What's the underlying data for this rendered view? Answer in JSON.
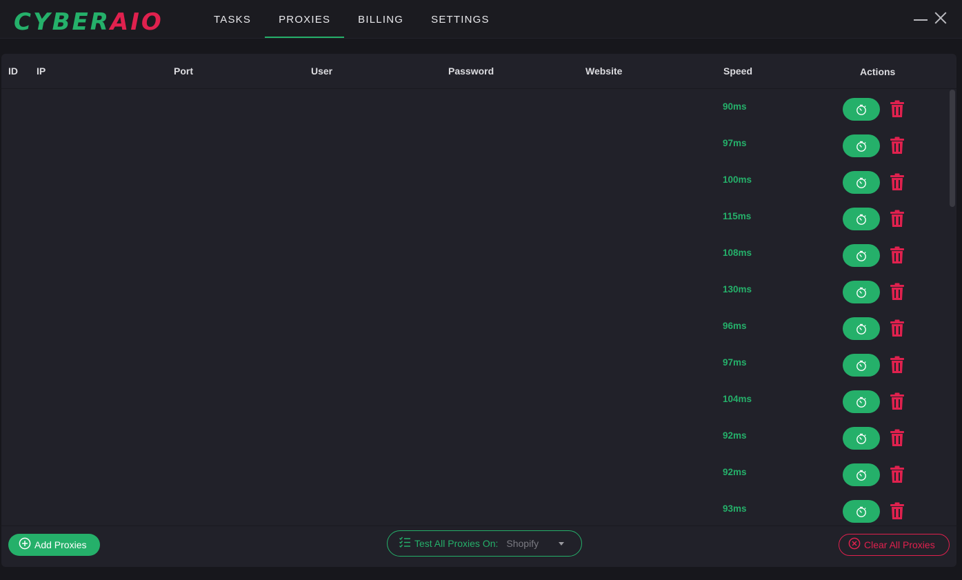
{
  "app": {
    "logo_part1": "CYBER",
    "logo_part2": "AIO",
    "accent_color": "#25b06a",
    "danger_color": "#e0214e"
  },
  "nav": {
    "tabs": [
      {
        "label": "TASKS",
        "active": false
      },
      {
        "label": "PROXIES",
        "active": true
      },
      {
        "label": "BILLING",
        "active": false
      },
      {
        "label": "SETTINGS",
        "active": false
      }
    ]
  },
  "window_controls": {
    "minimize_icon": "minimize-icon",
    "close_icon": "close-icon"
  },
  "table": {
    "columns": [
      "ID",
      "IP",
      "Port",
      "User",
      "Password",
      "Website",
      "Speed",
      "Actions"
    ],
    "rows": [
      {
        "speed": "90ms"
      },
      {
        "speed": "97ms"
      },
      {
        "speed": "100ms"
      },
      {
        "speed": "115ms"
      },
      {
        "speed": "108ms"
      },
      {
        "speed": "130ms"
      },
      {
        "speed": "96ms"
      },
      {
        "speed": "97ms"
      },
      {
        "speed": "104ms"
      },
      {
        "speed": "92ms"
      },
      {
        "speed": "92ms"
      },
      {
        "speed": "93ms"
      }
    ],
    "row_actions": {
      "test_icon": "stopwatch-icon",
      "delete_icon": "trash-icon"
    }
  },
  "footer": {
    "add_proxies_label": "Add Proxies",
    "test_all_label": "Test All Proxies On:",
    "test_all_value": "Shopify",
    "clear_all_label": "Clear All Proxies"
  }
}
